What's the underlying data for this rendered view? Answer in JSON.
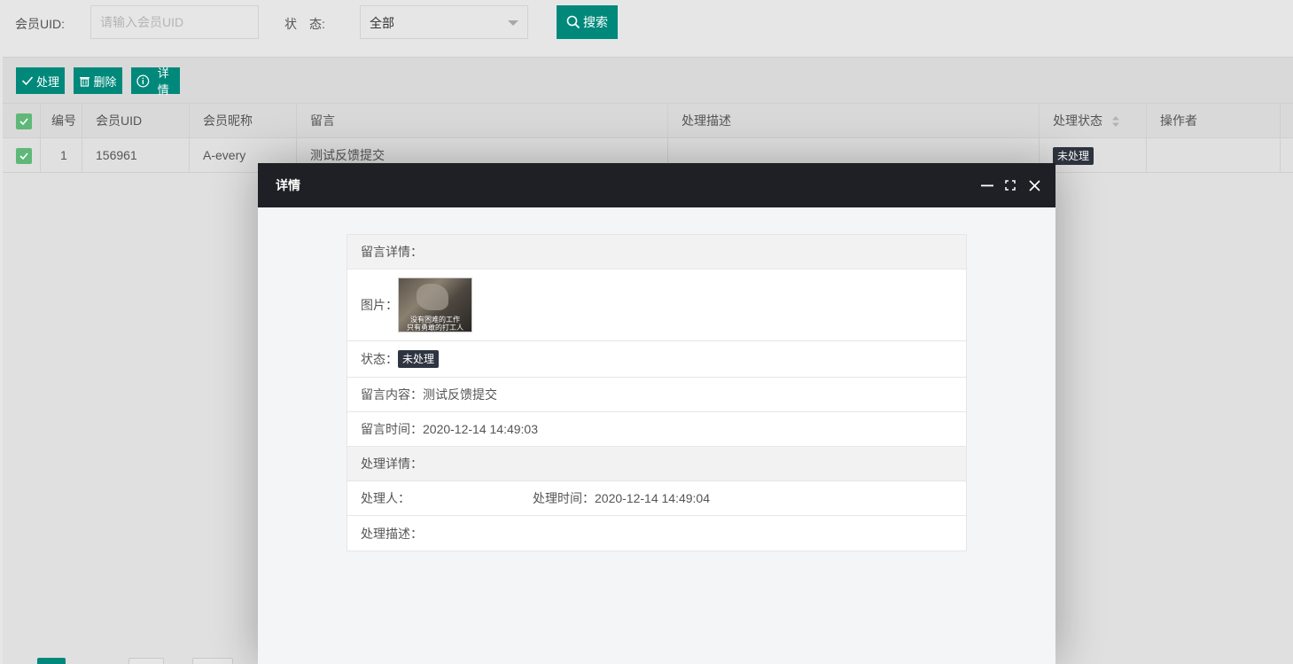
{
  "search": {
    "uid_label": "会员UID:",
    "uid_placeholder": "请输入会员UID",
    "status_label": "状　态:",
    "status_value": "全部",
    "search_button": "搜索"
  },
  "toolbar": {
    "process_label": "处理",
    "delete_label": "删除",
    "detail_label": "详情"
  },
  "table": {
    "headers": [
      "编号",
      "会员UID",
      "会员昵称",
      "留言",
      "处理描述",
      "处理状态",
      "操作者"
    ],
    "rows": [
      {
        "id": "1",
        "uid": "156961",
        "nickname": "A-every",
        "message": "测试反馈提交",
        "description": "",
        "status": "未处理",
        "operator": ""
      }
    ]
  },
  "modal": {
    "title": "详情",
    "message_section": "留言详情：",
    "image_label": "图片：",
    "image_caption_1": "没有困难的工作",
    "image_caption_2": "只有勇敢的打工人",
    "status_label": "状态：",
    "status_value": "未处理",
    "content_label": "留言内容：",
    "content_value": "测试反馈提交",
    "time_label": "留言时间：",
    "time_value": "2020-12-14 14:49:03",
    "process_section": "处理详情：",
    "handler_label": "处理人：",
    "handler_value": "",
    "process_time_label": "处理时间：",
    "process_time_value": "2020-12-14 14:49:04",
    "process_desc_label": "处理描述：",
    "process_desc_value": ""
  },
  "colors": {
    "primary": "#00897b",
    "checkbox": "#5fb878",
    "badge": "#2f3540",
    "modal_header": "#1f1f26"
  }
}
